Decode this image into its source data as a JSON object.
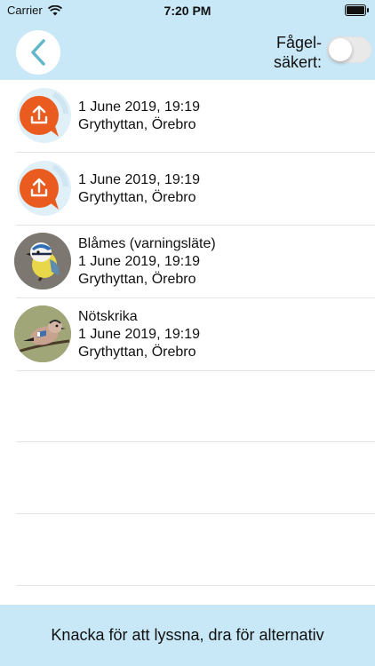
{
  "status_bar": {
    "carrier": "Carrier",
    "time": "7:20 PM"
  },
  "nav": {
    "toggle_label_line1": "Fågel-",
    "toggle_label_line2": "säkert:",
    "toggle_on": false
  },
  "recordings": [
    {
      "type": "upload",
      "title": "",
      "date": "1 June 2019, 19:19",
      "place": "Grythyttan, Örebro"
    },
    {
      "type": "upload",
      "title": "",
      "date": "1 June 2019, 19:19",
      "place": "Grythyttan, Örebro"
    },
    {
      "type": "bird",
      "bird_icon": "blue-tit-photo",
      "title": "Blåmes (varningsläte)",
      "date": "1 June 2019, 19:19",
      "place": "Grythyttan, Örebro"
    },
    {
      "type": "bird",
      "bird_icon": "jay-photo",
      "title": "Nötskrika",
      "date": "1 June 2019, 19:19",
      "place": "Grythyttan, Örebro"
    }
  ],
  "footer": {
    "hint": "Knacka för att lyssna, dra för alternativ"
  },
  "colors": {
    "header_bg": "#c9e8f7",
    "accent_orange": "#ea5b1f",
    "accent_teal": "#5fb7c9"
  }
}
